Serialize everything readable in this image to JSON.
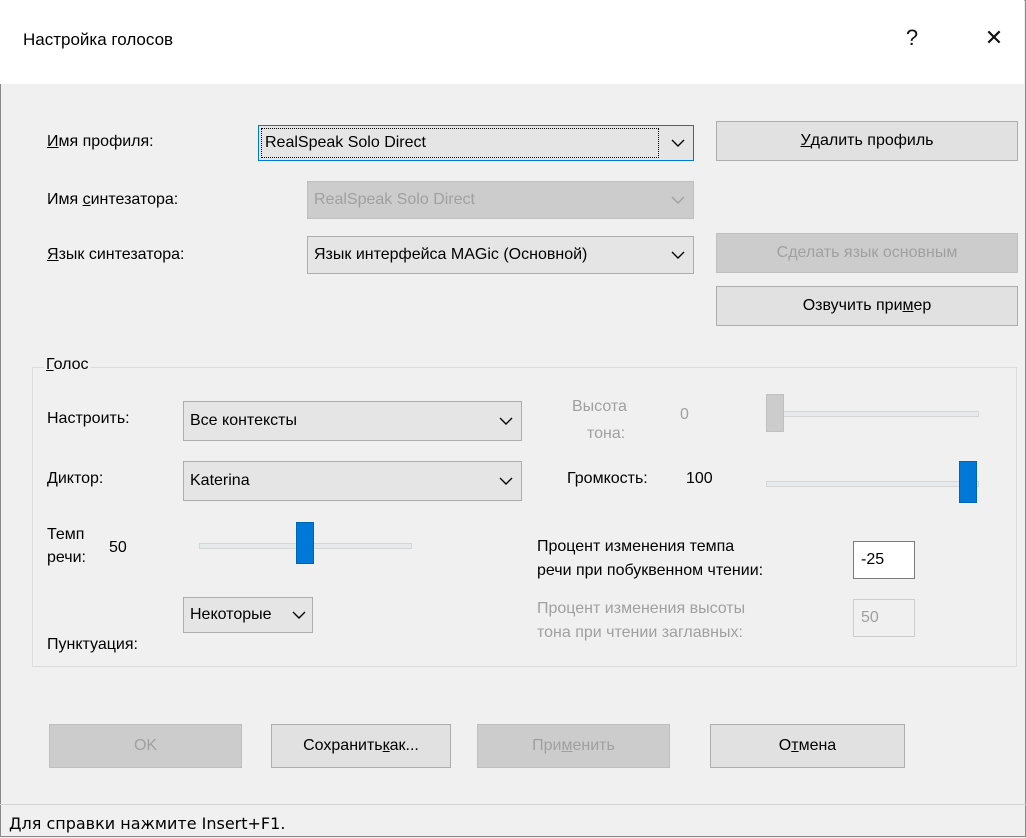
{
  "window": {
    "title": "Настройка голосов",
    "help_glyph": "?",
    "close_glyph": "✕"
  },
  "profile": {
    "label_u": "И",
    "label_rest": "мя профиля:",
    "value": "RealSpeak Solo Direct",
    "delete_u": "У",
    "delete_rest": "далить профиль"
  },
  "synth_name": {
    "label_a": "Имя ",
    "label_u": "с",
    "label_b": "интезатора:",
    "value": "RealSpeak Solo Direct"
  },
  "synth_lang": {
    "label_u": "Я",
    "label_rest": "зык синтезатора:",
    "value": "Язык интерфейса MAGic (Основной)",
    "make_default": "Сделать язык основным",
    "sample_a": "Озвучить при",
    "sample_u": "м",
    "sample_b": "ер"
  },
  "voice_group": {
    "title_u": "Г",
    "title_rest": "олос",
    "tune_label": "Настроить:",
    "tune_value": "Все контексты",
    "speaker_label": "Диктор:",
    "speaker_value": "Katerina",
    "rate_label_1": "Темп",
    "rate_label_2": "речи:",
    "rate_value": "50",
    "rate_level": 0.5,
    "punct_label": "Пунктуация:",
    "punct_value": "Некоторые",
    "pitch_label_1": "Высота",
    "pitch_label_2": "тона:",
    "pitch_value": "0",
    "pitch_level": 0.0,
    "volume_label": "Громкость:",
    "volume_value": "100",
    "volume_level": 1.0,
    "spell_rate_1": "Процент изменения темпа",
    "spell_rate_2": "речи при побуквенном чтении:",
    "spell_rate_value": "-25",
    "caps_pitch_1": "Процент изменения высоты",
    "caps_pitch_2": "тона при чтении заглавных:",
    "caps_pitch_value": "50"
  },
  "buttons": {
    "ok": "OK",
    "save_as_a": "Сохранить ",
    "save_as_u": "к",
    "save_as_b": "ак...",
    "apply_a": "При",
    "apply_u": "м",
    "apply_b": "енить",
    "cancel_a": "О",
    "cancel_u": "т",
    "cancel_b": "мена"
  },
  "status": {
    "text": "Для справки нажмите Insert+F1."
  },
  "icons": {
    "dropdown": "chevron-down-icon",
    "help": "help-icon",
    "close": "close-icon"
  },
  "colors": {
    "accent": "#0078d7",
    "disabled_text": "#a0a0a0",
    "dialog_bg": "#f0f0f0"
  }
}
